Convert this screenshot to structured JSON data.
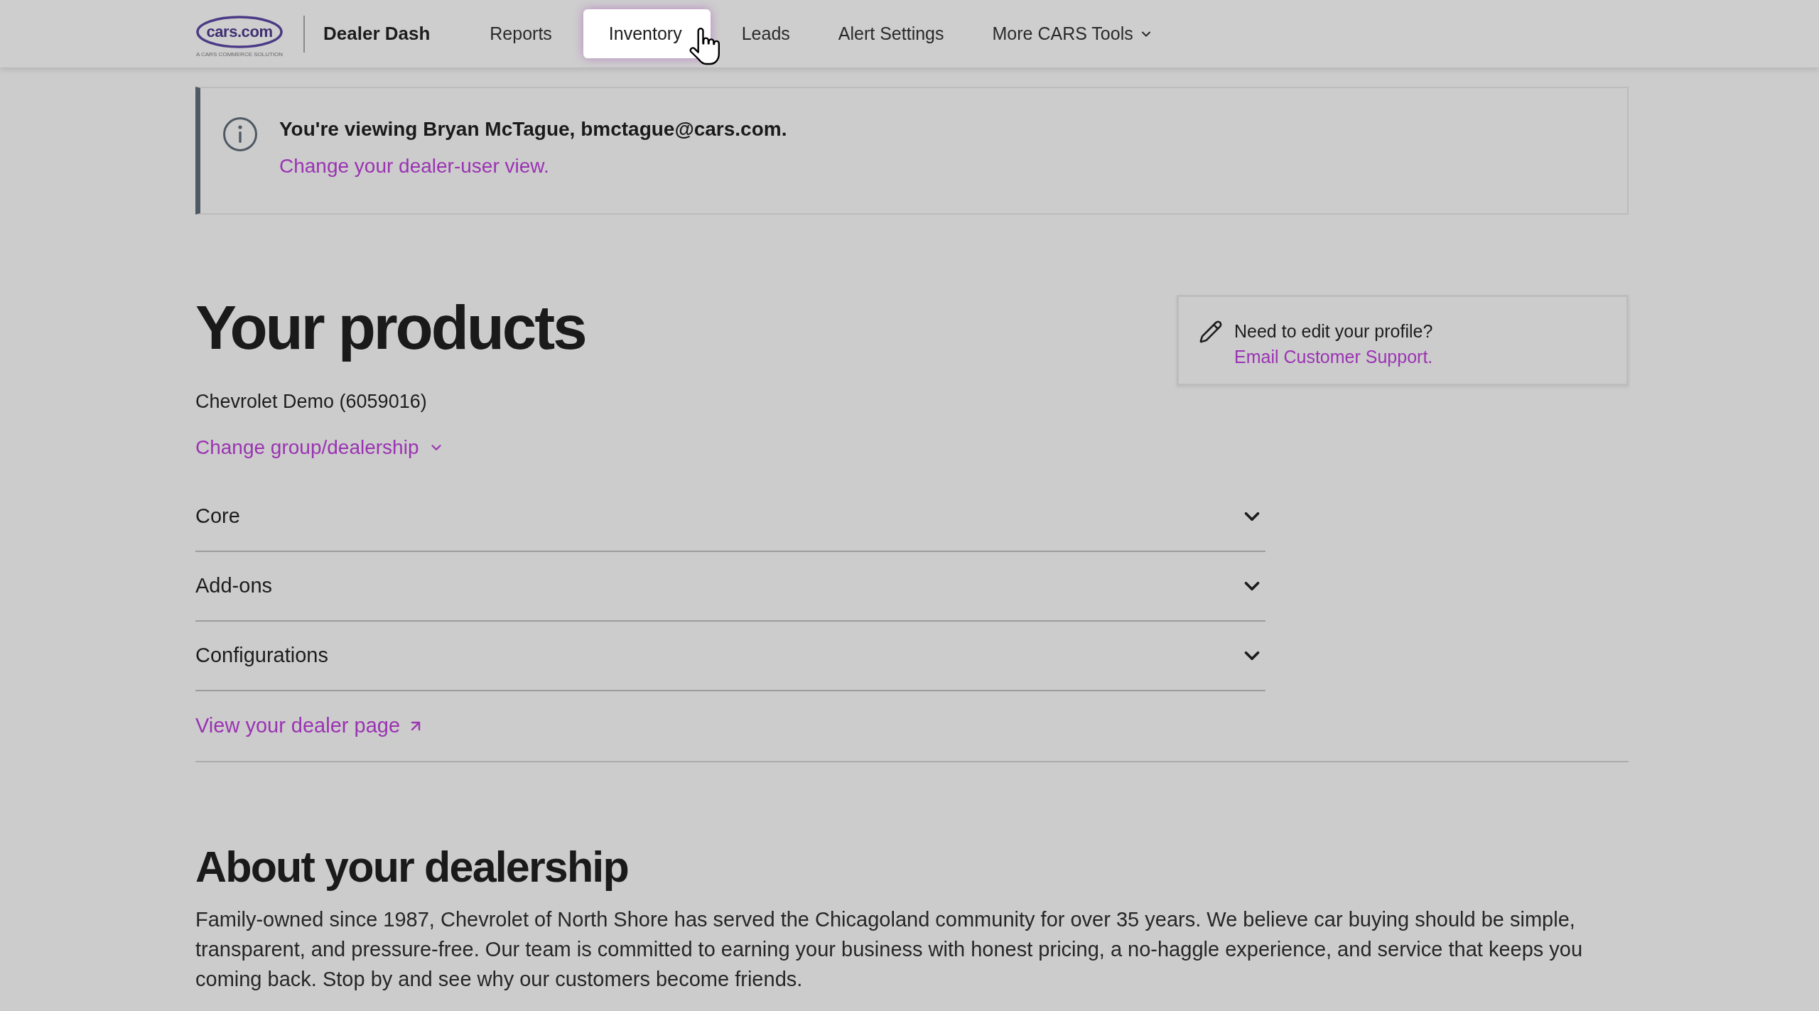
{
  "nav": {
    "logo": {
      "wordmark": "cars.com",
      "tagline": "A CARS COMMERCE SOLUTION"
    },
    "app_name": "Dealer Dash",
    "items": [
      {
        "label": "Reports",
        "kind": "link",
        "selected": false
      },
      {
        "label": "Inventory",
        "kind": "link",
        "selected": true
      },
      {
        "label": "Leads",
        "kind": "link",
        "selected": false
      },
      {
        "label": "Alert Settings",
        "kind": "link",
        "selected": false
      },
      {
        "label": "More CARS Tools",
        "kind": "dropdown",
        "selected": false
      }
    ]
  },
  "banner": {
    "message": "You're viewing Bryan McTague, bmctague@cars.com.",
    "link": "Change your dealer-user view."
  },
  "products": {
    "title": "Your products",
    "dealer": "Chevrolet Demo (6059016)",
    "change_link": "Change group/dealership",
    "sections": [
      {
        "label": "Core",
        "expanded": false
      },
      {
        "label": "Add-ons",
        "expanded": false
      },
      {
        "label": "Configurations",
        "expanded": false
      }
    ],
    "dealer_page_link": "View your dealer page"
  },
  "profile_note": {
    "text": "Need to edit your profile?",
    "link": "Email Customer Support."
  },
  "about": {
    "title": "About your dealership",
    "body": "Family-owned since 1987, Chevrolet of North Shore has served the Chicagoland community for over 35 years. We believe car buying should be simple, transparent, and pressure-free. Our team is committed to earning your business with honest pricing, a no-haggle experience, and service that keeps you coming back. Stop by and see why our customers become friends."
  }
}
